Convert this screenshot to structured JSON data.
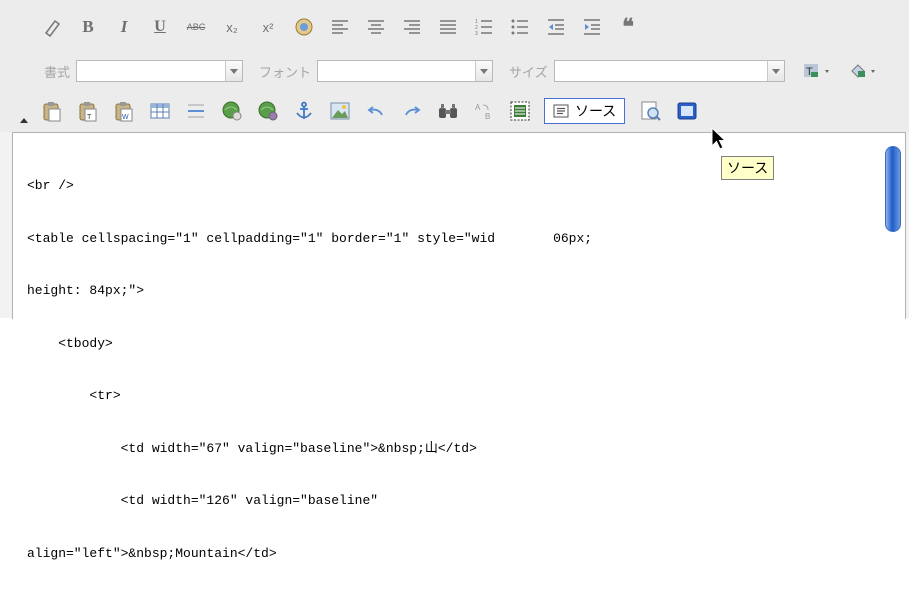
{
  "toolbar": {
    "row1": [
      "eraser-icon",
      "bold-icon",
      "italic-icon",
      "underline-icon",
      "strikethrough-icon",
      "subscript-icon",
      "superscript-icon",
      "special-char-icon",
      "align-left-icon",
      "align-center-icon",
      "align-right-icon",
      "justify-icon",
      "numbered-list-icon",
      "bullet-list-icon",
      "outdent-icon",
      "indent-icon",
      "blockquote-icon"
    ],
    "bold": "B",
    "italic": "I",
    "underline": "U",
    "strike": "ABC",
    "subscript": "x₂",
    "superscript": "x²",
    "quote": "❝",
    "format_label": "書式",
    "font_label": "フォント",
    "size_label": "サイズ",
    "format_value": "",
    "font_value": "",
    "size_value": "",
    "source_label": "ソース"
  },
  "editor": {
    "code_lines": [
      "<br />",
      "<table cellspacing=\"1\" cellpadding=\"1\" border=\"1\" style=\"wid",
      "height: 84px;\">",
      "    <tbody>",
      "        <tr>",
      "            <td width=\"67\" valign=\"baseline\">&nbsp;山</td>",
      "            <td width=\"126\" valign=\"baseline\"",
      "align=\"left\">&nbsp;Mountain</td>"
    ],
    "code_line2_tail": "06px;"
  },
  "tooltip": {
    "text": "ソース"
  },
  "colors": {
    "accent": "#4a6fd3",
    "scroll": "#1e5cc9",
    "tooltip_bg": "#ffffc8"
  }
}
